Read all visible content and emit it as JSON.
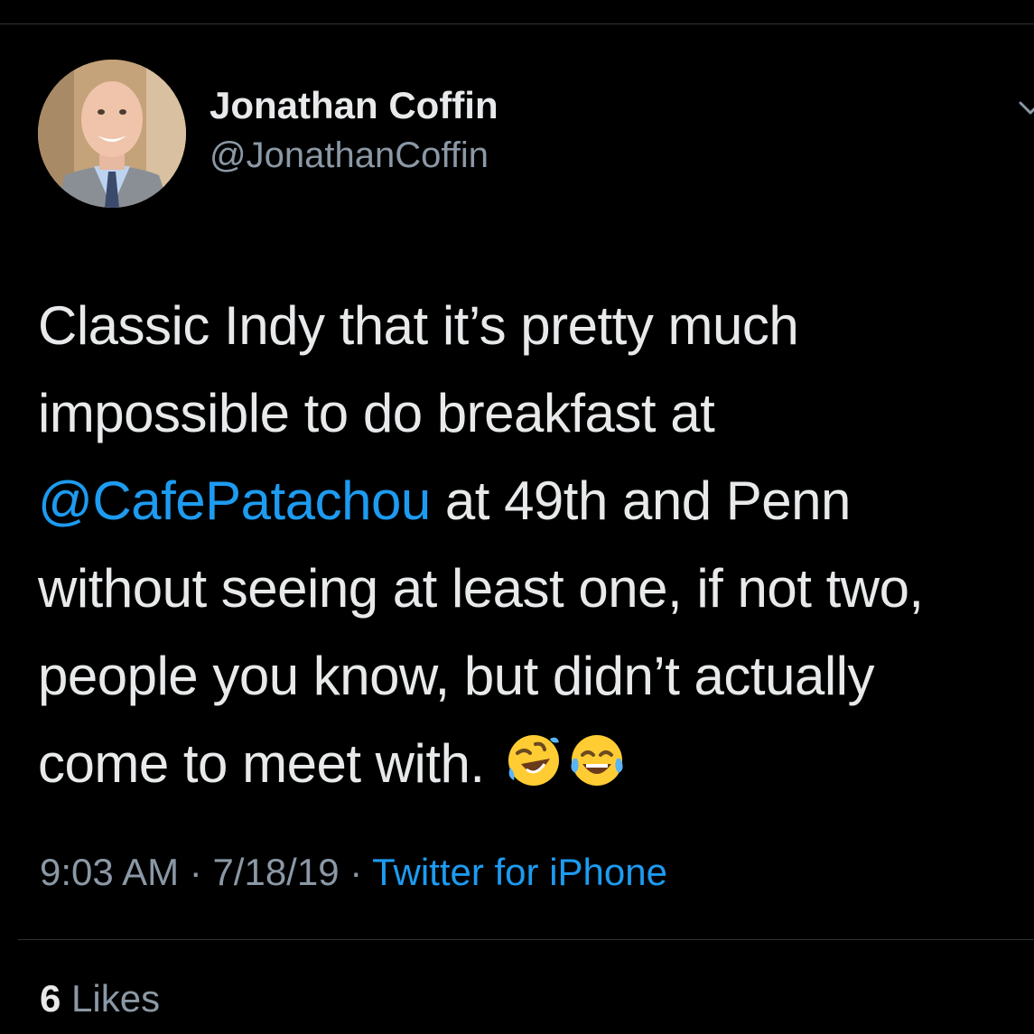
{
  "author": {
    "name": "Jonathan Coffin",
    "handle": "@JonathanCoffin"
  },
  "tweet": {
    "line1": "Classic Indy that it’s pretty much",
    "line2": "impossible to do breakfast at",
    "mention": "@CafePatachou",
    "line3_rest": " at 49th and Penn",
    "line4": "without seeing at least one, if not two,",
    "line5": "people you know, but didn’t actually",
    "line6": "come to meet with. ",
    "emojis": [
      "rolling-on-floor-laughing-emoji",
      "tears-of-joy-emoji"
    ]
  },
  "meta": {
    "time": "9:03 AM",
    "sep1": " · ",
    "date": "7/18/19",
    "sep2": " · ",
    "source": "Twitter for iPhone"
  },
  "stats": {
    "likes_count": "6",
    "likes_label": " Likes"
  },
  "colors": {
    "background": "#000000",
    "text": "#e7e9ea",
    "secondary": "#8b98a5",
    "link": "#1d9bf0",
    "divider": "#2f3336"
  }
}
